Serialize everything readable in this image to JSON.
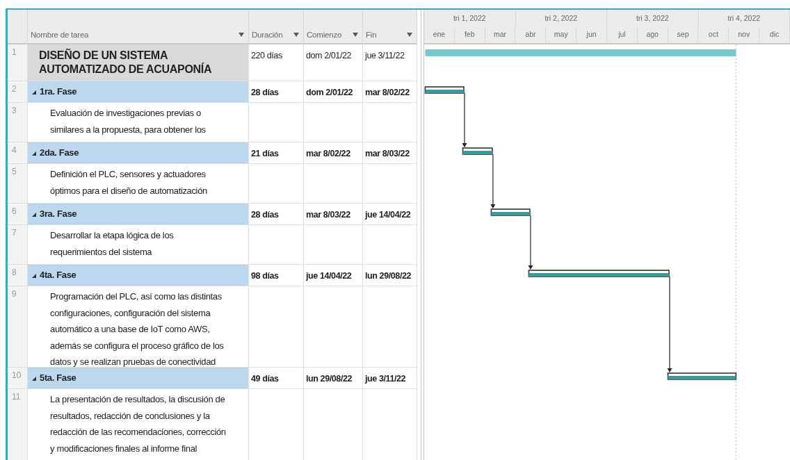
{
  "table": {
    "columns": [
      {
        "label": "Nombre de tarea"
      },
      {
        "label": "Duración"
      },
      {
        "label": "Comienzo"
      },
      {
        "label": "Fin"
      }
    ],
    "rows": [
      {
        "id": "1",
        "kind": "project",
        "lines": [
          "DISEÑO DE UN SISTEMA",
          "AUTOMATIZADO DE ACUAPONÍA"
        ],
        "duration": "220 días",
        "start": "dom 2/01/22",
        "end": "jue 3/11/22"
      },
      {
        "id": "2",
        "kind": "phase",
        "expanded": true,
        "lines": [
          "1ra. Fase"
        ],
        "duration": "28 días",
        "start": "dom 2/01/22",
        "end": "mar 8/02/22"
      },
      {
        "id": "3",
        "kind": "task",
        "lines": [
          "Evaluación de investigaciones previas o",
          "similares a la propuesta, para obtener los"
        ]
      },
      {
        "id": "4",
        "kind": "phase",
        "expanded": true,
        "lines": [
          "2da. Fase"
        ],
        "duration": "21 días",
        "start": "mar 8/02/22",
        "end": "mar 8/03/22"
      },
      {
        "id": "5",
        "kind": "task",
        "lines": [
          "Definición el PLC, sensores y actuadores",
          "óptimos para el diseño de automatización"
        ]
      },
      {
        "id": "6",
        "kind": "phase",
        "expanded": true,
        "lines": [
          "3ra. Fase"
        ],
        "duration": "28 días",
        "start": "mar 8/03/22",
        "end": "jue 14/04/22"
      },
      {
        "id": "7",
        "kind": "task",
        "lines": [
          "Desarrollar la etapa lógica de los",
          "requerimientos del sistema"
        ]
      },
      {
        "id": "8",
        "kind": "phase",
        "expanded": true,
        "lines": [
          "4ta. Fase"
        ],
        "duration": "98 días",
        "start": "jue 14/04/22",
        "end": "lun 29/08/22"
      },
      {
        "id": "9",
        "kind": "task",
        "lines": [
          "Programación del PLC, así como las distintas",
          "configuraciones, configuración del sistema",
          "automático a una base de IoT como AWS,",
          "además se configura el proceso gráfico de los",
          "datos y se realizan pruebas de conectividad"
        ]
      },
      {
        "id": "10",
        "kind": "phase",
        "expanded": true,
        "lines": [
          "5ta. Fase"
        ],
        "duration": "49 días",
        "start": "lun 29/08/22",
        "end": "jue 3/11/22"
      },
      {
        "id": "11",
        "kind": "task",
        "lines": [
          "La presentación de resultados, la discusión de",
          "resultados, redacción de conclusiones y la",
          "redacción de las recomendaciones, corrección",
          "y modificaciones finales al informe final"
        ]
      }
    ]
  },
  "gantt": {
    "quarters": [
      "tri 1, 2022",
      "tri 2, 2022",
      "tri 3, 2022",
      "tri 4, 2022"
    ],
    "months": [
      "ene",
      "feb",
      "mar",
      "abr",
      "may",
      "jun",
      "jul",
      "ago",
      "sep",
      "oct",
      "nov",
      "dic"
    ]
  }
}
